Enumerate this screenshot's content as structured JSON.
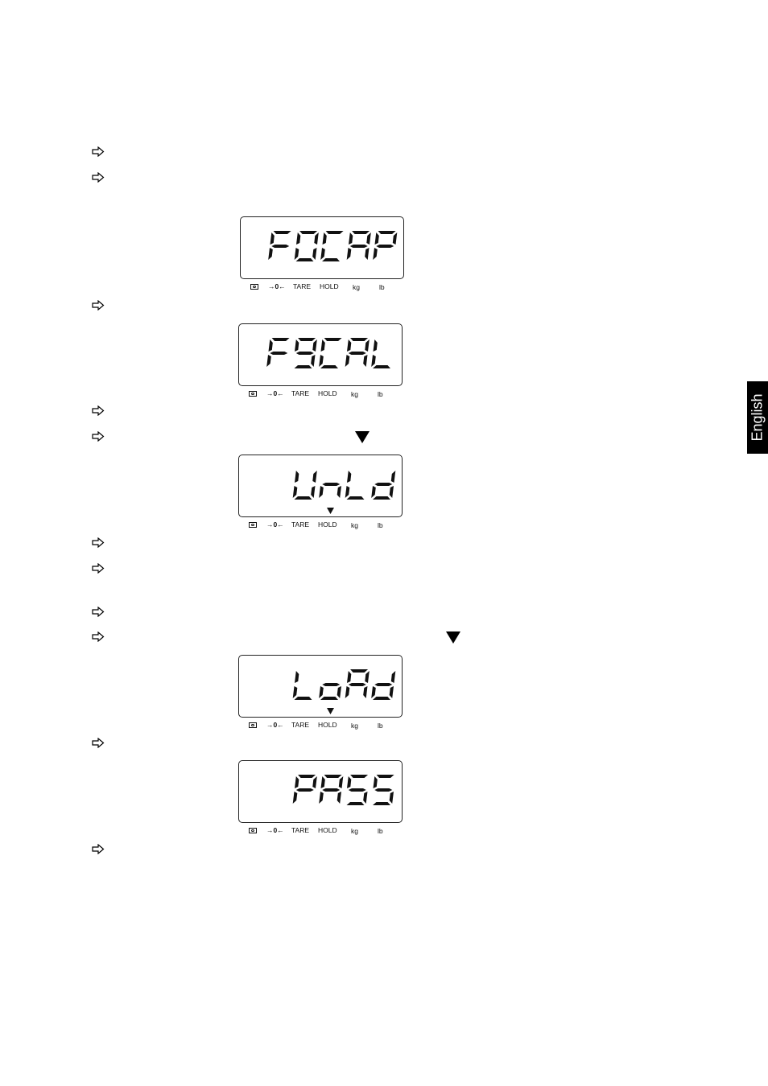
{
  "page": {
    "language_tab": "English",
    "accent_colors": {
      "ink": "#000000",
      "background": "#ffffff",
      "tab_text": "#ffffff"
    }
  },
  "steps": [
    {
      "icon": "hollow-right-arrow"
    },
    {
      "icon": "hollow-right-arrow"
    },
    {
      "icon": "hollow-right-arrow"
    },
    {
      "icon": "hollow-right-arrow"
    },
    {
      "icon": "hollow-right-arrow",
      "inline_marker": "down-triangle"
    },
    {
      "icon": "hollow-right-arrow"
    },
    {
      "icon": "hollow-right-arrow"
    },
    {
      "icon": "hollow-right-arrow"
    },
    {
      "icon": "hollow-right-arrow",
      "inline_marker": "down-triangle"
    },
    {
      "icon": "hollow-right-arrow"
    },
    {
      "icon": "hollow-right-arrow"
    }
  ],
  "displays": [
    {
      "text": "F0CAP",
      "stability_marker": false
    },
    {
      "text": "F9CAL",
      "stability_marker": false
    },
    {
      "text": "UnLd",
      "stability_marker": true
    },
    {
      "text": "LoAd",
      "stability_marker": true
    },
    {
      "text": "PASS",
      "stability_marker": false
    }
  ],
  "annunciators": {
    "battery": "battery-icon",
    "zero": "→0←",
    "tare": "TARE",
    "hold": "HOLD",
    "kg": "kg",
    "lb": "lb"
  }
}
